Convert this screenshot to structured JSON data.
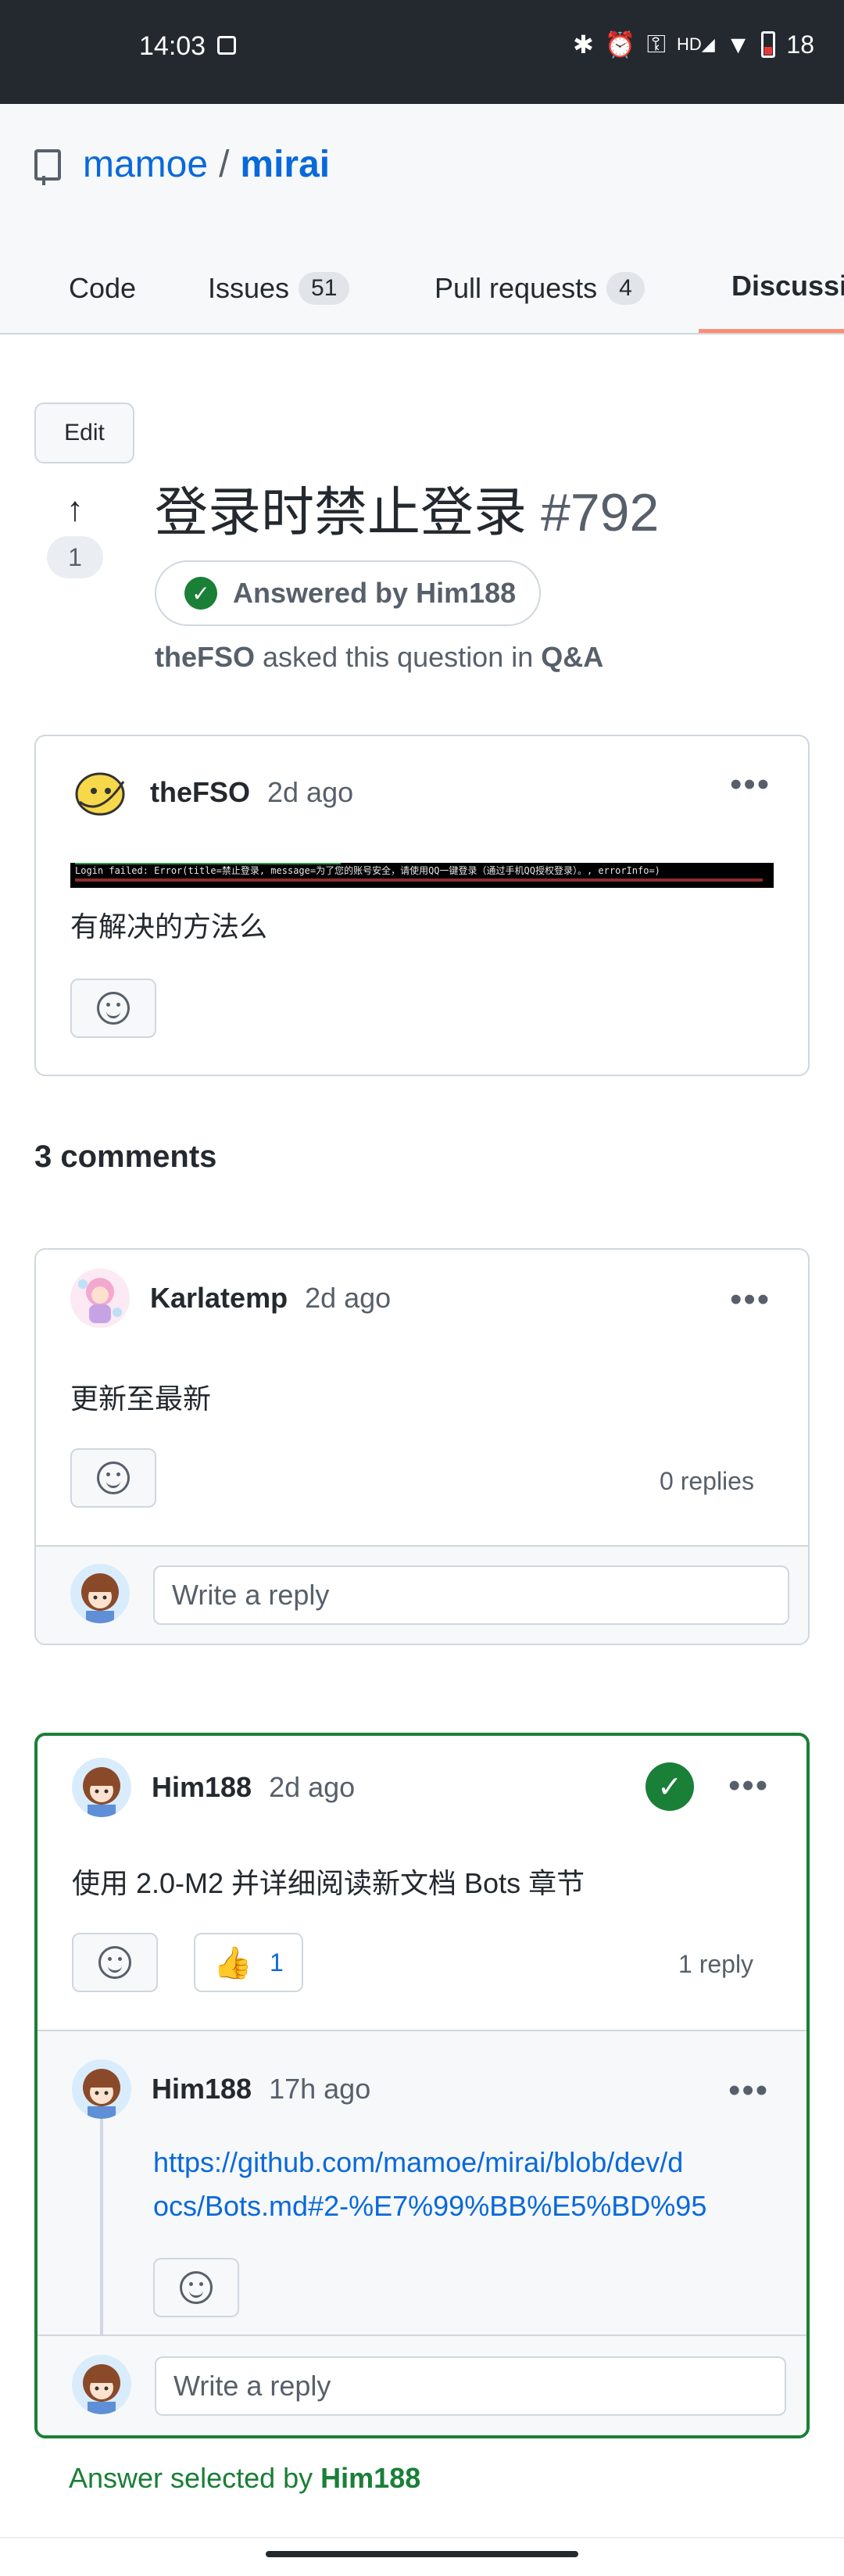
{
  "status_bar": {
    "time": "14:03",
    "battery": "18",
    "hd_label": "HD"
  },
  "repo": {
    "owner": "mamoe",
    "separator": "/",
    "name": "mirai"
  },
  "tabs": [
    {
      "label": "Code"
    },
    {
      "label": "Issues",
      "count": "51"
    },
    {
      "label": "Pull requests",
      "count": "4"
    },
    {
      "label": "Discussi"
    }
  ],
  "discussion": {
    "edit_label": "Edit",
    "votes": "1",
    "title": "登录时禁止登录",
    "number": "#792",
    "answered_label": "Answered by Him188",
    "asker": "theFSO",
    "asked_text": "asked this question in",
    "category": "Q&A"
  },
  "original_post": {
    "author": "theFSO",
    "time": "2d ago",
    "log_line": "Login failed: Error(title=禁止登录, message=为了您的账号安全，请使用QQ一键登录（通过手机QQ授权登录）。, errorInfo=)",
    "body": "有解决的方法么"
  },
  "comments_heading": "3 comments",
  "comment_1": {
    "author": "Karlatemp",
    "time": "2d ago",
    "body": "更新至最新",
    "replies": "0 replies",
    "reply_placeholder": "Write a reply"
  },
  "comment_2": {
    "author": "Him188",
    "time": "2d ago",
    "body": "使用 2.0-M2 并详细阅读新文档 Bots 章节",
    "reaction_count": "1",
    "replies": "1 reply",
    "reply": {
      "author": "Him188",
      "time": "17h ago",
      "link_line1": "https://github.com/mamoe/mirai/blob/dev/d",
      "link_line2": "ocs/Bots.md#2-%E7%99%BB%E5%BD%95"
    },
    "reply_placeholder": "Write a reply",
    "answer_selected_text": "Answer selected by",
    "answer_selected_by": "Him188"
  }
}
